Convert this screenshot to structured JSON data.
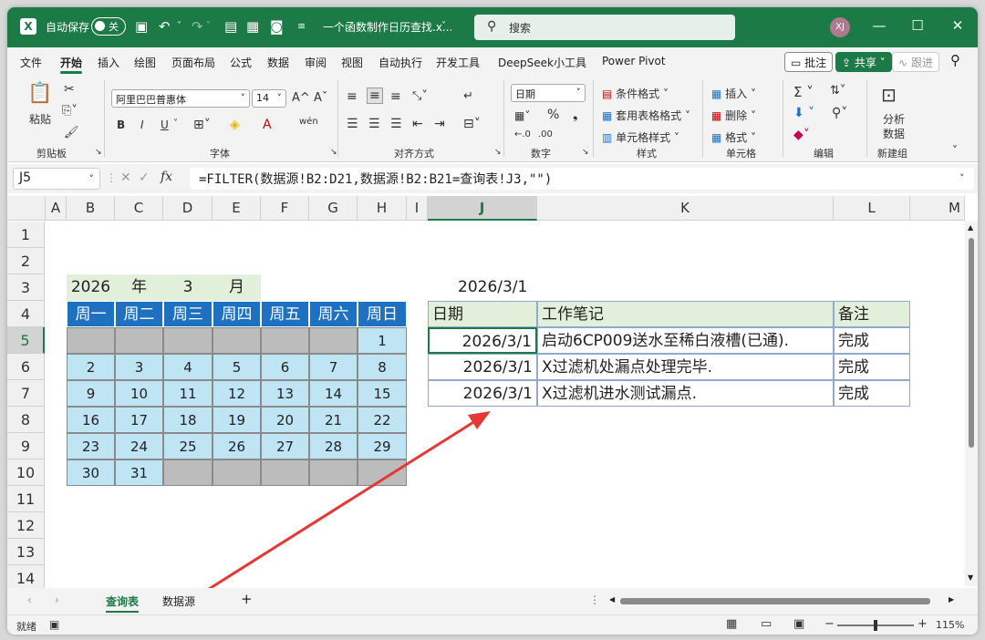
{
  "titlebar": {
    "autosave_label": "自动保存",
    "autosave_state": "关",
    "doc_title": "一个函数制作日历查找.x...",
    "search_placeholder": "搜索",
    "user_initials": "XJ",
    "minimize": "—",
    "maximize": "☐",
    "close": "✕"
  },
  "menu": {
    "tabs": [
      "文件",
      "开始",
      "插入",
      "绘图",
      "页面布局",
      "公式",
      "数据",
      "审阅",
      "视图",
      "自动执行",
      "开发工具",
      "DeepSeek小工具",
      "Power Pivot"
    ],
    "active_tab": "开始",
    "comment_btn": "批注",
    "share_btn": "共享",
    "follow_btn": "跟进"
  },
  "ribbon": {
    "clipboard": {
      "group": "剪贴板",
      "paste": "粘贴"
    },
    "font": {
      "group": "字体",
      "font_name": "阿里巴巴普惠体",
      "font_size": "14",
      "bold": "B",
      "italic": "I",
      "underline": "U",
      "grow": "A^",
      "shrink": "Aˇ"
    },
    "align": {
      "group": "对齐方式"
    },
    "number": {
      "group": "数字",
      "format": "日期"
    },
    "styles": {
      "group": "样式",
      "cond": "条件格式",
      "table": "套用表格格式",
      "cell": "单元格样式"
    },
    "cells": {
      "group": "单元格",
      "insert": "插入",
      "delete": "删除",
      "format": "格式"
    },
    "editing": {
      "group": "编辑"
    },
    "analysis": {
      "group": "新建组",
      "btn1": "分析",
      "btn2": "数据"
    }
  },
  "formula_bar": {
    "name_box": "J5",
    "fx": "fx",
    "formula": "=FILTER(数据源!B2:D21,数据源!B2:B21=查询表!J3,\"\")"
  },
  "columns": [
    "A",
    "B",
    "C",
    "D",
    "E",
    "F",
    "G",
    "H",
    "I",
    "J",
    "K",
    "L",
    "M"
  ],
  "rows": [
    "1",
    "2",
    "3",
    "4",
    "5",
    "6",
    "7",
    "8",
    "9",
    "10",
    "11",
    "12",
    "13",
    "14"
  ],
  "calendar": {
    "year": "2026",
    "year_label": "年",
    "month": "3",
    "month_label": "月",
    "weekdays": [
      "周一",
      "周二",
      "周三",
      "周四",
      "周五",
      "周六",
      "周日"
    ],
    "weeks": [
      [
        "",
        "",
        "",
        "",
        "",
        "",
        "1"
      ],
      [
        "2",
        "3",
        "4",
        "5",
        "6",
        "7",
        "8"
      ],
      [
        "9",
        "10",
        "11",
        "12",
        "13",
        "14",
        "15"
      ],
      [
        "16",
        "17",
        "18",
        "19",
        "20",
        "21",
        "22"
      ],
      [
        "23",
        "24",
        "25",
        "26",
        "27",
        "28",
        "29"
      ],
      [
        "30",
        "31",
        "",
        "",
        "",
        "",
        ""
      ]
    ]
  },
  "query": {
    "date": "2026/3/1",
    "headers": [
      "日期",
      "工作笔记",
      "备注"
    ],
    "rows": [
      [
        "2026/3/1",
        "启动6CP009送水至稀白液槽(已通).",
        "完成"
      ],
      [
        "2026/3/1",
        "X过滤机处漏点处理完毕.",
        "完成"
      ],
      [
        "2026/3/1",
        "X过滤机进水测试漏点.",
        "完成"
      ]
    ]
  },
  "sheets": [
    "查询表",
    "数据源"
  ],
  "active_sheet": "查询表",
  "status": {
    "ready": "就绪",
    "zoom": "115%"
  },
  "colors": {
    "accent": "#1b7a45",
    "cal_header": "#1e71c1",
    "cal_cell": "#bfe4f4",
    "cal_empty": "#bcbcbc",
    "ym_bg": "#e2efda",
    "arrow": "#e53935"
  }
}
